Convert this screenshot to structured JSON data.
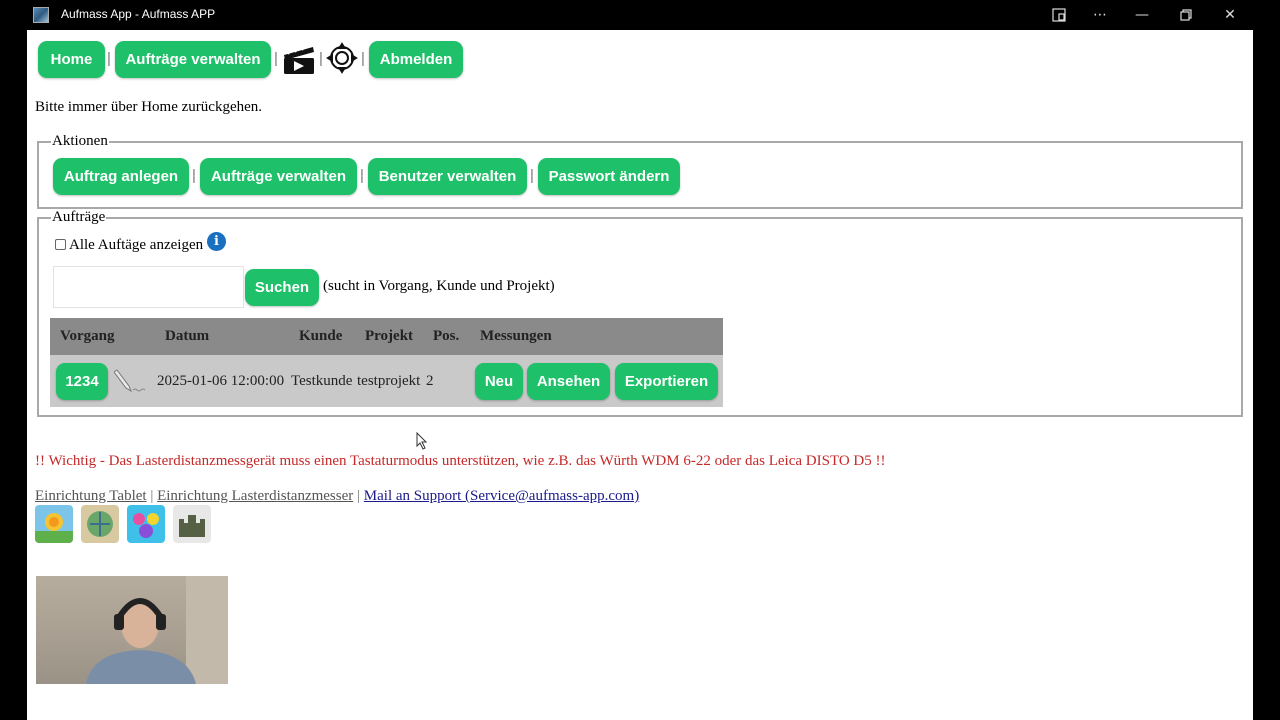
{
  "window": {
    "title": "Aufmass App - Aufmass APP"
  },
  "nav": {
    "home": "Home",
    "manage_orders": "Aufträge verwalten",
    "logout": "Abmelden",
    "separator": "|"
  },
  "hint": "Bitte immer über Home zurückgehen.",
  "actions": {
    "legend": "Aktionen",
    "create_order": "Auftrag anlegen",
    "manage_orders": "Aufträge verwalten",
    "manage_users": "Benutzer verwalten",
    "change_password": "Passwort ändern"
  },
  "orders": {
    "legend": "Aufträge",
    "show_all_label": "Alle Auftäge anzeigen",
    "search_value": "",
    "search_button": "Suchen",
    "search_hint": "(sucht in Vorgang, Kunde und Projekt)",
    "columns": [
      "Vorgang",
      "Datum",
      "Kunde",
      "Projekt",
      "Pos.",
      "Messungen"
    ],
    "rows": [
      {
        "vorgang": "1234",
        "datum": "2025-01-06 12:00:00",
        "kunde": "Testkunde",
        "projekt": "testprojekt",
        "pos": "2",
        "btn_new": "Neu",
        "btn_view": "Ansehen",
        "btn_export": "Exportieren"
      }
    ]
  },
  "warning": "!! Wichtig - Das Lasterdistanzmessgerät muss einen Tastaturmodus unterstützen, wie z.B. das Würth WDM 6-22 oder das Leica DISTO D5 !!",
  "links": {
    "tablet": "Einrichtung Tablet",
    "laser": "Einrichtung Lasterdistanzmesser",
    "mail": "Mail an Support (Service@aufmass-app.com)",
    "separator": "|"
  },
  "colors": {
    "button_green": "#1fc06a",
    "warning_red": "#c62828",
    "table_header": "#8a8a8a",
    "table_row": "#c9c9c9"
  }
}
